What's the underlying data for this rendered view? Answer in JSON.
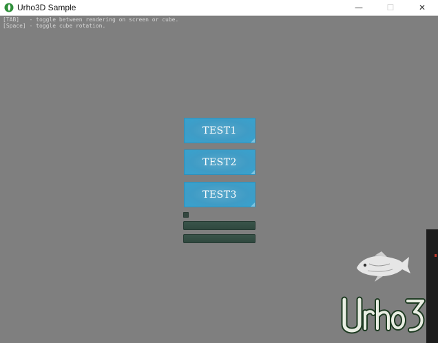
{
  "window": {
    "title": "Urho3D Sample",
    "minimize_glyph": "—",
    "maximize_glyph": "☐",
    "close_glyph": "✕",
    "app_icon": "urho3d-leaf-icon"
  },
  "help_text": {
    "line1": "[TAB]   - toggle between rendering on screen or cube.",
    "line2": "[Space] - toggle cube rotation."
  },
  "buttons": [
    {
      "label": "TEST1"
    },
    {
      "label": "TEST2"
    },
    {
      "label": "TEST3"
    }
  ],
  "colors": {
    "viewport_bg": "#7f7f7f",
    "button_bg": "#3f9cc6",
    "input_bg": "#33463f"
  },
  "decorations": {
    "fish": "urho-fish-icon",
    "logo": "urho3d-logo"
  }
}
